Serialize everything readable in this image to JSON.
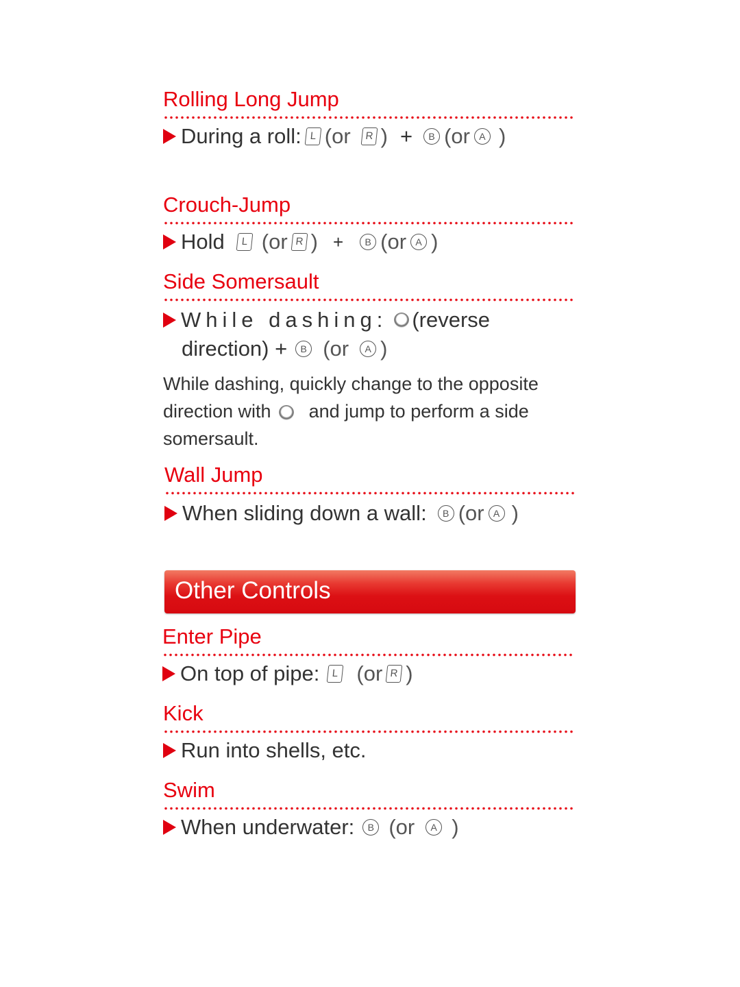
{
  "sections": {
    "rolling_long_jump": {
      "title": "Rolling Long Jump",
      "prefix": "During a roll:",
      "btn1": "L",
      "or1": "(or",
      "btn2": "R",
      "close1": ")",
      "plus": "+",
      "btn3": "B",
      "or2": "(or",
      "btn4": "A",
      "close2": ")"
    },
    "crouch_jump": {
      "title": "Crouch-Jump",
      "prefix": "Hold",
      "btn1": "L",
      "or1": "(or",
      "btn2": "R",
      "close1": ")",
      "plus": "+",
      "btn3": "B",
      "or2": "(or",
      "btn4": "A",
      "close2": ")"
    },
    "side_somersault": {
      "title": "Side Somersault",
      "prefix": "While dashing:",
      "suffix1": "(reverse",
      "line2_prefix": "direction) +",
      "btn3": "B",
      "or2": "(or",
      "btn4": "A",
      "close2": ")",
      "desc_line1": "While dashing, quickly change to the opposite",
      "desc_line2_a": "direction with",
      "desc_line2_b": "and jump to perform a side",
      "desc_line3": "somersault."
    },
    "wall_jump": {
      "title": "Wall Jump",
      "prefix": "When sliding down a wall:",
      "btn3": "B",
      "or2": "(or",
      "btn4": "A",
      "close2": ")"
    },
    "other_controls_banner": "Other Controls",
    "enter_pipe": {
      "title": "Enter Pipe",
      "prefix": "On top of pipe:",
      "btn1": "L",
      "or1": "(or",
      "btn2": "R",
      "close1": ")"
    },
    "kick": {
      "title": "Kick",
      "prefix": "Run into shells, etc."
    },
    "swim": {
      "title": "Swim",
      "prefix": "When underwater:",
      "btn3": "B",
      "or2": "(or",
      "btn4": "A",
      "close2": ")"
    }
  },
  "colors": {
    "heading_red": "#e8000f",
    "banner_red": "#dc1014",
    "body_text": "#333333"
  }
}
